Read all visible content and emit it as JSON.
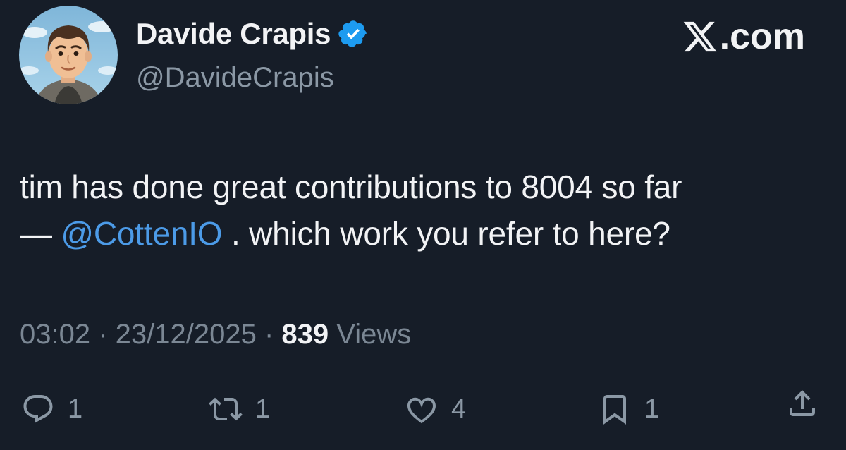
{
  "author": {
    "display_name": "Davide Crapis",
    "handle": "@DavideCrapis",
    "verified": true,
    "avatar_icon": "cartoon-avatar-icon"
  },
  "brand": {
    "label": ".com",
    "logo_icon": "x-logo-icon"
  },
  "tweet": {
    "text_line1": "tim has done great contributions to 8004 so far",
    "text_dash": "— ",
    "mention": "@CottenIO",
    "text_line2_rest": " . which work you refer to here?",
    "time": "03:02",
    "separator": " · ",
    "date": "23/12/2025",
    "views_count": "839",
    "views_label": " Views"
  },
  "actions": {
    "reply": {
      "icon": "reply-icon",
      "count": "1"
    },
    "repost": {
      "icon": "repost-icon",
      "count": "1"
    },
    "like": {
      "icon": "heart-icon",
      "count": "4"
    },
    "bookmark": {
      "icon": "bookmark-icon",
      "count": "1"
    },
    "share": {
      "icon": "share-icon"
    }
  },
  "colors": {
    "background": "#161d28",
    "text": "#f2f3f5",
    "secondary_text": "#8b98a5",
    "link": "#4c9be8",
    "verified_badge": "#1d9bf0"
  }
}
